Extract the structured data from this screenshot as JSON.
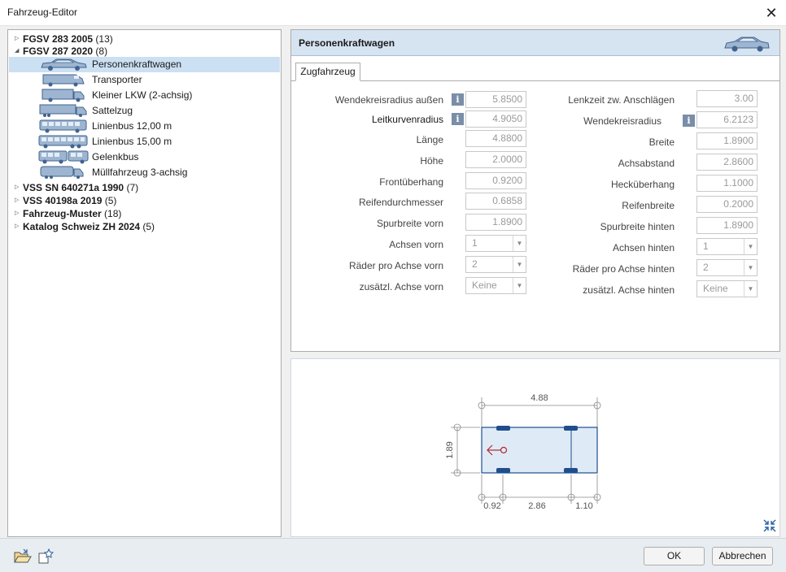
{
  "window": {
    "title": "Fahrzeug-Editor",
    "close_glyph": "✕"
  },
  "tree": {
    "groups": [
      {
        "label": "FGSV 283 2005",
        "count": "(13)",
        "expanded": false
      },
      {
        "label": "FGSV 287 2020",
        "count": "(8)",
        "expanded": true
      },
      {
        "label": "VSS SN 640271a 1990",
        "count": "(7)",
        "expanded": false
      },
      {
        "label": "VSS 40198a 2019",
        "count": "(5)",
        "expanded": false
      },
      {
        "label": "Fahrzeug-Muster",
        "count": "(18)",
        "expanded": false
      },
      {
        "label": "Katalog Schweiz ZH 2024",
        "count": "(5)",
        "expanded": false
      }
    ],
    "children": [
      {
        "label": "Personenkraftwagen",
        "icon": "car-icon",
        "selected": true
      },
      {
        "label": "Transporter",
        "icon": "van-icon"
      },
      {
        "label": "Kleiner LKW (2-achsig)",
        "icon": "small-truck-icon"
      },
      {
        "label": "Sattelzug",
        "icon": "semi-truck-icon"
      },
      {
        "label": "Linienbus 12,00 m",
        "icon": "bus-icon"
      },
      {
        "label": "Linienbus 15,00 m",
        "icon": "bus-icon"
      },
      {
        "label": "Gelenkbus",
        "icon": "articulated-bus-icon"
      },
      {
        "label": "Müllfahrzeug 3-achsig",
        "icon": "garbage-truck-icon"
      }
    ]
  },
  "panel": {
    "title": "Personenkraftwagen",
    "tab": "Zugfahrzeug",
    "left_fields": [
      {
        "label": "Wendekreisradius außen",
        "value": "5.8500",
        "info": true
      },
      {
        "label": "Leitkurvenradius",
        "value": "4.9050",
        "info": true
      },
      {
        "label": "Länge",
        "value": "4.8800"
      },
      {
        "label": "Höhe",
        "value": "2.0000"
      },
      {
        "label": "Frontüberhang",
        "value": "0.9200"
      },
      {
        "label": "Reifendurchmesser",
        "value": "0.6858"
      },
      {
        "label": "Spurbreite vorn",
        "value": "1.8900"
      },
      {
        "label": "Achsen vorn",
        "value": "1",
        "select": true
      },
      {
        "label": "Räder pro Achse vorn",
        "value": "2",
        "select": true
      },
      {
        "label": "zusätzl. Achse vorn",
        "value": "Keine",
        "select": true
      }
    ],
    "right_fields": [
      {
        "label": "Lenkzeit zw. Anschlägen",
        "value": "3.00"
      },
      {
        "label": "Wendekreisradius",
        "value": "6.2123",
        "info": true
      },
      {
        "label": "Breite",
        "value": "1.8900"
      },
      {
        "label": "Achsabstand",
        "value": "2.8600"
      },
      {
        "label": "Hecküberhang",
        "value": "1.1000"
      },
      {
        "label": "Reifenbreite",
        "value": "0.2000"
      },
      {
        "label": "Spurbreite hinten",
        "value": "1.8900"
      },
      {
        "label": "Achsen hinten",
        "value": "1",
        "select": true
      },
      {
        "label": "Räder pro Achse hinten",
        "value": "2",
        "select": true
      },
      {
        "label": "zusätzl. Achse hinten",
        "value": "Keine",
        "select": true
      }
    ],
    "info_glyph": "i"
  },
  "preview": {
    "length_label": "4.88",
    "width_label": "1.89",
    "front_label": "0.92",
    "wheelbase_label": "2.86",
    "rear_label": "1.10"
  },
  "buttons": {
    "ok": "OK",
    "cancel": "Abbrechen"
  },
  "colors": {
    "header_bg": "#d6e4f2",
    "selection": "#cce0f3",
    "vehicle_fill": "#dfeaf7",
    "vehicle_stroke": "#1f4e8c",
    "arrow": "#b0282d"
  }
}
